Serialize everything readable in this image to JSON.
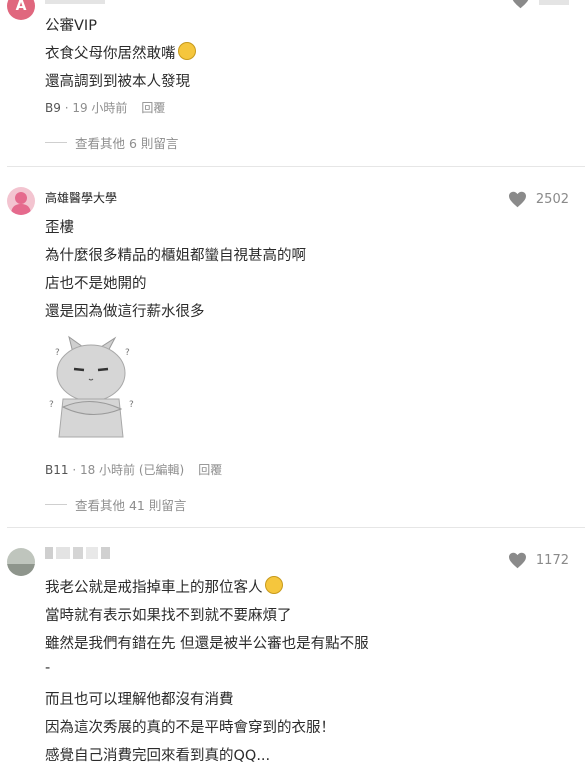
{
  "comment1": {
    "avatar_letter": "A",
    "lines": [
      "公審VIP",
      "衣食父母你居然敢嘴",
      "還高調到到被本人發現"
    ],
    "floor": "B9",
    "time": "19 小時前",
    "reply": "回覆",
    "more_replies": "查看其他 6 則留言"
  },
  "comment2": {
    "author": "高雄醫學大學",
    "likes": "2502",
    "lines": [
      "歪樓",
      "為什麼很多精品的櫃姐都蠻自視甚高的啊",
      "店也不是她開的",
      "還是因為做這行薪水很多"
    ],
    "floor": "B11",
    "time": "18 小時前 (已編輯)",
    "reply": "回覆",
    "more_replies": "查看其他 41 則留言"
  },
  "comment3": {
    "likes": "1172",
    "lines": [
      "我老公就是戒指掉車上的那位客人",
      "當時就有表示如果找不到就不要麻煩了",
      "雖然是我們有錯在先 但還是被半公審也是有點不服",
      "-",
      "而且也可以理解他都沒有消費",
      "因為這次秀展的真的不是平時會穿到的衣服！",
      "感覺自己消費完回來看到真的QQ..."
    ]
  },
  "colors": {
    "accent_avatar1": "#e0677e",
    "avatar2": "#e56a8d",
    "heart": "#8a8a8a"
  }
}
